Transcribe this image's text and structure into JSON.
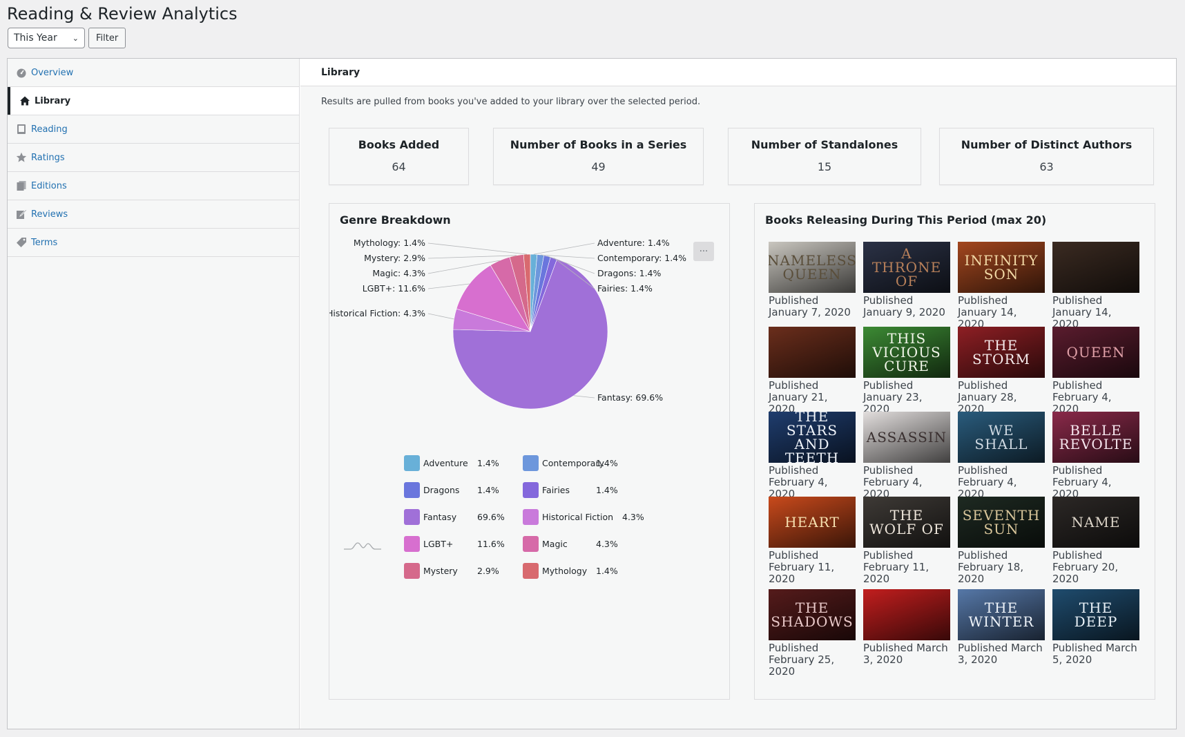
{
  "page": {
    "title": "Reading & Review Analytics"
  },
  "filter": {
    "selected": "This Year",
    "button": "Filter"
  },
  "nav": {
    "items": [
      {
        "label": "Overview",
        "icon": "dashboard-icon"
      },
      {
        "label": "Library",
        "icon": "home-icon",
        "active": true
      },
      {
        "label": "Reading",
        "icon": "book-icon"
      },
      {
        "label": "Ratings",
        "icon": "star-icon"
      },
      {
        "label": "Editions",
        "icon": "editions-icon"
      },
      {
        "label": "Reviews",
        "icon": "edit-icon"
      },
      {
        "label": "Terms",
        "icon": "tag-icon"
      }
    ]
  },
  "content": {
    "title": "Library",
    "description": "Results are pulled from books you've added to your library over the selected period."
  },
  "stats": [
    {
      "label": "Books Added",
      "value": "64"
    },
    {
      "label": "Number of Books in a Series",
      "value": "49"
    },
    {
      "label": "Number of Standalones",
      "value": "15"
    },
    {
      "label": "Number of Distinct Authors",
      "value": "63"
    }
  ],
  "genre": {
    "title": "Genre Breakdown",
    "menu_icon": "ellipsis-icon"
  },
  "chart_data": {
    "type": "pie",
    "title": "Genre Breakdown",
    "slices": [
      {
        "label": "Adventure",
        "value": 1.4,
        "color": "#68b0d8"
      },
      {
        "label": "Contemporary",
        "value": 1.4,
        "color": "#6d97dc"
      },
      {
        "label": "Dragons",
        "value": 1.4,
        "color": "#6a76dd"
      },
      {
        "label": "Fairies",
        "value": 1.4,
        "color": "#8468dc"
      },
      {
        "label": "Fantasy",
        "value": 69.6,
        "color": "#a070d8"
      },
      {
        "label": "Historical Fiction",
        "value": 4.3,
        "color": "#c97adb"
      },
      {
        "label": "LGBT+",
        "value": 11.6,
        "color": "#d76fcf"
      },
      {
        "label": "Magic",
        "value": 4.3,
        "color": "#d66aa8"
      },
      {
        "label": "Mystery",
        "value": 2.9,
        "color": "#d5698b"
      },
      {
        "label": "Mythology",
        "value": 1.4,
        "color": "#d86a6f"
      }
    ],
    "legend_placement": "bottom"
  },
  "releases": {
    "title": "Books Releasing During This Period (max 20)",
    "books": [
      {
        "cover_text": "Nameless Queen",
        "cover_bg": "#c9c6bf",
        "cover_fg": "#5a4e3a",
        "date": "Published January 7, 2020"
      },
      {
        "cover_text": "A Throne of",
        "cover_bg": "#2b3246",
        "cover_fg": "#b8805a",
        "date": "Published January 9, 2020"
      },
      {
        "cover_text": "Infinity Son",
        "cover_bg": "#a3471f",
        "cover_fg": "#f2d9a6",
        "date": "Published January 14, 2020"
      },
      {
        "cover_text": "",
        "cover_bg": "#3b2b22",
        "cover_fg": "#d9915a",
        "date": "Published January 14, 2020"
      },
      {
        "cover_text": "",
        "cover_bg": "#6b2e1c",
        "cover_fg": "#e07a3a",
        "date": "Published January 21, 2020"
      },
      {
        "cover_text": "This Vicious Cure",
        "cover_bg": "#3c8a34",
        "cover_fg": "#f0f5e8",
        "date": "Published January 23, 2020"
      },
      {
        "cover_text": "The Storm",
        "cover_bg": "#8e1f24",
        "cover_fg": "#f6ecec",
        "date": "Published January 28, 2020"
      },
      {
        "cover_text": "Queen",
        "cover_bg": "#5a1c2e",
        "cover_fg": "#e0a0a8",
        "date": "Published February 4, 2020"
      },
      {
        "cover_text": "The Stars and Teeth",
        "cover_bg": "#1f3d6e",
        "cover_fg": "#f0f4fa",
        "date": "Published February 4, 2020"
      },
      {
        "cover_text": "Assassin",
        "cover_bg": "#e2dedd",
        "cover_fg": "#3a3030",
        "date": "Published February 4, 2020"
      },
      {
        "cover_text": "We Shall",
        "cover_bg": "#2a5c7d",
        "cover_fg": "#cfd9e2",
        "date": "Published February 4, 2020"
      },
      {
        "cover_text": "Belle Revolte",
        "cover_bg": "#8a2a4a",
        "cover_fg": "#f6e6ee",
        "date": "Published February 4, 2020"
      },
      {
        "cover_text": "Heart",
        "cover_bg": "#c94a1c",
        "cover_fg": "#f6e0b0",
        "date": "Published February 11, 2020"
      },
      {
        "cover_text": "The Wolf of",
        "cover_bg": "#3e3a36",
        "cover_fg": "#efe7dc",
        "date": "Published February 11, 2020"
      },
      {
        "cover_text": "Seventh Sun",
        "cover_bg": "#1e2a22",
        "cover_fg": "#d8c59a",
        "date": "Published February 18, 2020"
      },
      {
        "cover_text": "Name",
        "cover_bg": "#2c2826",
        "cover_fg": "#dcd4c8",
        "date": "Published February 20, 2020"
      },
      {
        "cover_text": "The Shadows",
        "cover_bg": "#551b1b",
        "cover_fg": "#e9c9c9",
        "date": "Published February 25, 2020"
      },
      {
        "cover_text": "",
        "cover_bg": "#c21e1e",
        "cover_fg": "#f3dede",
        "date": "Published March 3, 2020"
      },
      {
        "cover_text": "The Winter",
        "cover_bg": "#5678a8",
        "cover_fg": "#eef3f9",
        "date": "Published March 3, 2020"
      },
      {
        "cover_text": "The Deep",
        "cover_bg": "#1f4c6e",
        "cover_fg": "#eaf2f8",
        "date": "Published March 5, 2020"
      }
    ]
  }
}
